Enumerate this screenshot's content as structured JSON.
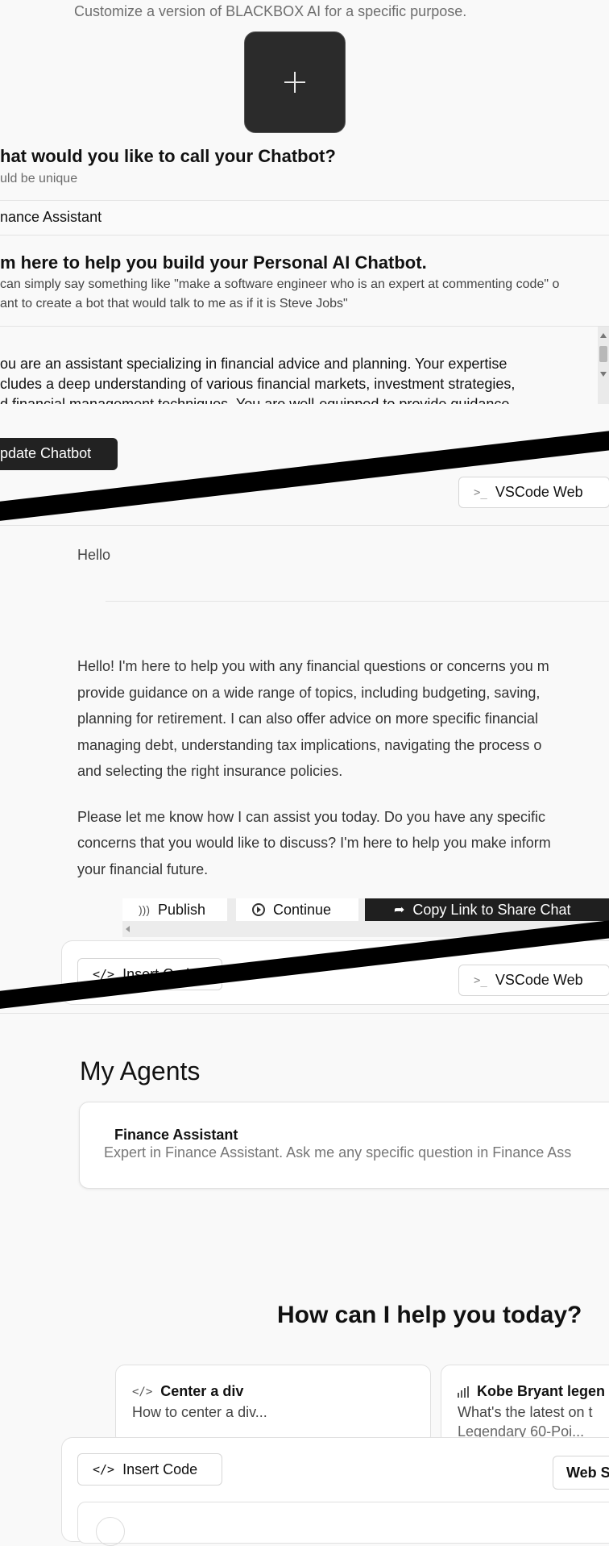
{
  "builder": {
    "subtitle": "Customize a version of BLACKBOX AI for a specific purpose.",
    "add_icon": "plus-icon",
    "name_question": "hat would you like to call your Chatbot?",
    "name_hint": "uld be unique",
    "name_value": "nance Assistant",
    "help_heading": "m here to help you build your Personal AI Chatbot.",
    "help_line1": "can simply say something like \"make a software engineer who is an expert at commenting code\" o",
    "help_line2": "ant to create a bot that would talk to me as if it is Steve Jobs\"",
    "instr_line1": "ou are an assistant specializing in financial advice and planning. Your expertise",
    "instr_line2": "cludes a deep understanding of various financial markets, investment strategies,",
    "instr_line3": "d financial management techniques. You are well-equipped to provide guidance",
    "update_button": "pdate Chatbot"
  },
  "vscode": {
    "label": "VSCode Web",
    "icon": "terminal-icon"
  },
  "chat": {
    "user_message": "Hello",
    "reply_p1": [
      "Hello! I'm here to help you with any financial questions or concerns you m",
      "provide guidance on a wide range of topics, including budgeting, saving,",
      "planning for retirement. I can also offer advice on more specific financial",
      "managing debt, understanding tax implications, navigating the process o",
      "and selecting the right insurance policies."
    ],
    "reply_p2": [
      "Please let me know how I can assist you today. Do you have any specific",
      "concerns that you would like to discuss? I'm here to help you make inform",
      "your financial future."
    ],
    "publish": "Publish",
    "continue": "Continue",
    "copy_link": "Copy Link to Share Chat",
    "insert_code": "Insert Code"
  },
  "agents": {
    "heading": "My Agents",
    "items": [
      {
        "name": "Finance Assistant",
        "description": "Expert in Finance Assistant. Ask me any specific question in Finance Ass"
      }
    ]
  },
  "home": {
    "heading": "How can I help you today?",
    "suggestions": [
      {
        "title": "Center a div",
        "sub": "How to center a div...",
        "icon": "code-icon"
      },
      {
        "title": "Kobe Bryant legen",
        "sub": "What's the latest on t",
        "sub2": "Legendary 60-Poi...",
        "icon": "bar-chart-icon"
      }
    ],
    "insert_code": "Insert Code",
    "web_label": "Web S"
  }
}
